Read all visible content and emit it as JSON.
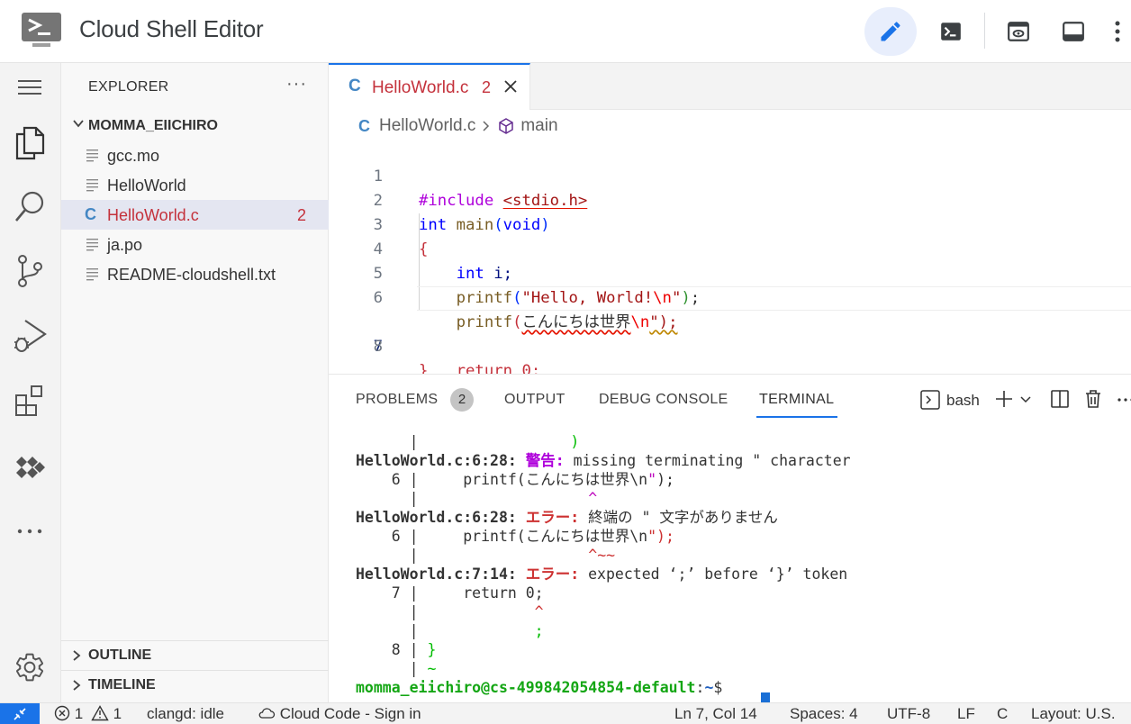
{
  "header": {
    "title": "Cloud Shell Editor",
    "buttons": [
      "edit-icon",
      "terminal-icon",
      "preview-icon",
      "panel-icon",
      "more-icon"
    ]
  },
  "activity_bar": [
    "menu-icon",
    "files-icon",
    "search-icon",
    "source-control-icon",
    "run-debug-icon",
    "extensions-icon",
    "cloud-code-icon",
    "more-icon",
    "settings-icon"
  ],
  "sidebar": {
    "title": "EXPLORER",
    "more": "···",
    "folder": "MOMMA_EIICHIRO",
    "files": [
      {
        "name": "gcc.mo",
        "type": "text",
        "badge": ""
      },
      {
        "name": "HelloWorld",
        "type": "text",
        "badge": ""
      },
      {
        "name": "HelloWorld.c",
        "type": "c",
        "badge": "2"
      },
      {
        "name": "ja.po",
        "type": "text",
        "badge": ""
      },
      {
        "name": "README-cloudshell.txt",
        "type": "text",
        "badge": ""
      }
    ],
    "outline": "OUTLINE",
    "timeline": "TIMELINE"
  },
  "editor": {
    "tab": {
      "icon_letter": "C",
      "name": "HelloWorld.c",
      "badge": "2"
    },
    "breadcrumb": {
      "file": "HelloWorld.c",
      "separator": ">",
      "symbol": "main"
    },
    "line_numbers": [
      "1",
      "2",
      "3",
      "4",
      "5",
      "6",
      "7",
      "8"
    ],
    "current_line": 7,
    "code": {
      "l1_a": "#include ",
      "l1_b": "<stdio.h>",
      "l2_a": "int",
      "l2_b": " main",
      "l2_c": "(",
      "l2_d": "void",
      "l2_e": ")",
      "l3": "{",
      "l4_a": "    ",
      "l4_b": "int",
      "l4_c": " i;",
      "l5_a": "    ",
      "l5_b": "printf",
      "l5_c": "(",
      "l5_d": "\"Hello, World!",
      "l5_e": "\\n",
      "l5_f": "\"",
      "l5_g": ")",
      "l5_h": ";",
      "l6_a": "    ",
      "l6_b": "printf",
      "l6_c": "(",
      "l6_d": "こんにちは世界",
      "l6_e": "\\n",
      "l6_f": "\");",
      "l7_a": "    ",
      "l7_b": "return",
      "l7_c": " ",
      "l7_d": "0",
      "l7_e": ";",
      "l8": "}"
    }
  },
  "panel": {
    "tabs": [
      "PROBLEMS",
      "OUTPUT",
      "DEBUG CONSOLE",
      "TERMINAL"
    ],
    "problems_count": "2",
    "active_tab": "TERMINAL",
    "terminal_name": "bash",
    "terminal": {
      "l0_a": "      |",
      "l0_b": "                 )",
      "l1_a": "HelloWorld.c:6:28: ",
      "l1_b": "警告: ",
      "l1_c": "missing terminating \" character",
      "l2_a": "    6 |     printf(こんにちは世界\\n",
      "l2_b": "\"",
      "l2_c": ");",
      "l3_a": "      |",
      "l3_b": "                   ^",
      "l4_a": "HelloWorld.c:6:28: ",
      "l4_b": "エラー: ",
      "l4_c": "終端の \" 文字がありません",
      "l5_a": "    6 |     printf(こんにちは世界\\n",
      "l5_b": "\");",
      "l6_a": "      |",
      "l6_b": "                   ^~~",
      "l7_a": "HelloWorld.c:7:14: ",
      "l7_b": "エラー: ",
      "l7_c": "expected ‘;’ before ‘}’ token",
      "l8": "    7 |     return 0;",
      "l9_a": "      |",
      "l9_b": "             ^",
      "l10_a": "      |",
      "l10_b": "             ;",
      "l11_a": "    8 | ",
      "l11_b": "}",
      "l12_a": "      | ",
      "l12_b": "~",
      "prompt_user": "momma_eiichiro@cs-499842054854-default",
      "prompt_sep": ":",
      "prompt_path": "~",
      "prompt_end": "$ "
    }
  },
  "statusbar": {
    "errors": "1",
    "warnings": "1",
    "clangd": "clangd: idle",
    "cloud_code": "Cloud Code - Sign in",
    "position": "Ln 7, Col 14",
    "spaces": "Spaces: 4",
    "encoding": "UTF-8",
    "eol": "LF",
    "language": "C",
    "layout": "Layout: U.S."
  },
  "colors": {
    "accent": "#1a73e8",
    "error": "#c4313b",
    "c_icon": "#4487c4"
  }
}
